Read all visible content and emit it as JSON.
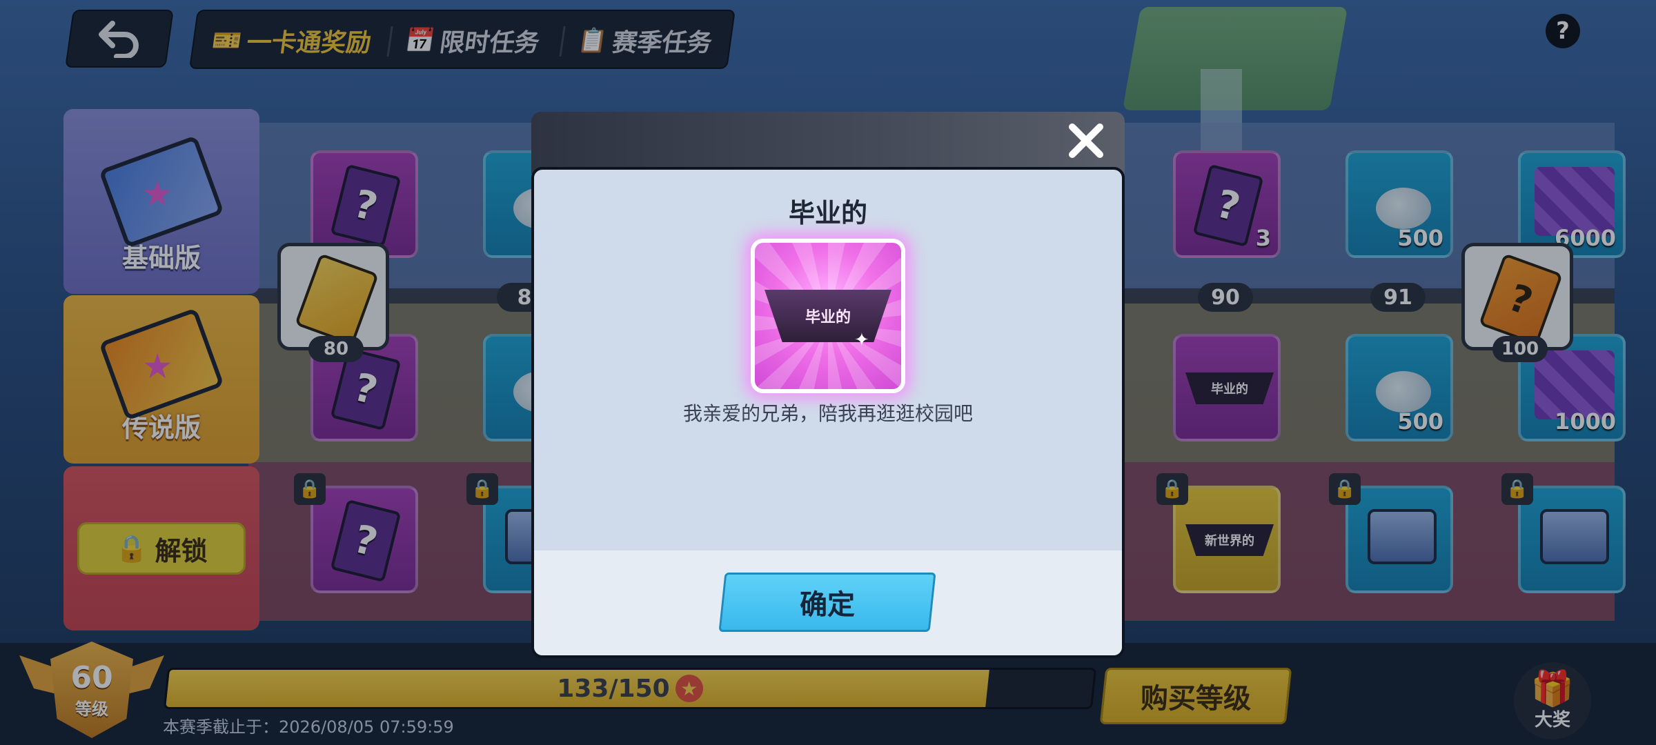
{
  "header": {
    "tabs": [
      {
        "label": "一卡通奖励",
        "icon": "ticket-icon",
        "active": true
      },
      {
        "label": "限时任务",
        "icon": "calendar-icon",
        "active": false
      },
      {
        "label": "赛季任务",
        "icon": "clipboard-icon",
        "active": false
      }
    ],
    "help": "?"
  },
  "tiers": {
    "basic": "基础版",
    "legend": "传说版",
    "unlock": "解锁"
  },
  "track": {
    "levels": [
      "80",
      "8",
      "90",
      "91",
      "100"
    ],
    "milestone_left": "80",
    "milestone_right": "100",
    "milestone_right_symbol": "?"
  },
  "items": {
    "basic": [
      {
        "type": "mystery",
        "count": "",
        "symbol": "?"
      },
      {
        "type": "coins",
        "count": ""
      },
      {
        "type": "mystery",
        "count": "3",
        "symbol": "?"
      },
      {
        "type": "coins",
        "count": "500"
      },
      {
        "type": "cubes",
        "count": "6000"
      }
    ],
    "legend": [
      {
        "type": "mystery",
        "count": "",
        "symbol": "?"
      },
      {
        "type": "coins",
        "count": ""
      },
      {
        "type": "title",
        "count": "",
        "text": "毕业的"
      },
      {
        "type": "coins",
        "count": "500"
      },
      {
        "type": "cubes",
        "count": "1000"
      }
    ],
    "locked": [
      {
        "type": "mystery",
        "count": "",
        "symbol": "?"
      },
      {
        "type": "chest",
        "count": ""
      },
      {
        "type": "title",
        "count": "",
        "text": "新世界的"
      },
      {
        "type": "chest",
        "count": ""
      },
      {
        "type": "chest",
        "count": ""
      }
    ]
  },
  "bottom": {
    "level": "60",
    "level_label": "等级",
    "exp_text": "133/150",
    "exp_current": 133,
    "exp_max": 150,
    "season_end": "本赛季截止于：2026/08/05 07:59:59",
    "buy_level": "购买等级",
    "grand_prize": "大奖"
  },
  "modal": {
    "title": "毕业的",
    "reward_text": "毕业的",
    "description": "我亲爱的兄弟，陪我再逛逛校园吧",
    "confirm": "确定",
    "close": "✕"
  }
}
